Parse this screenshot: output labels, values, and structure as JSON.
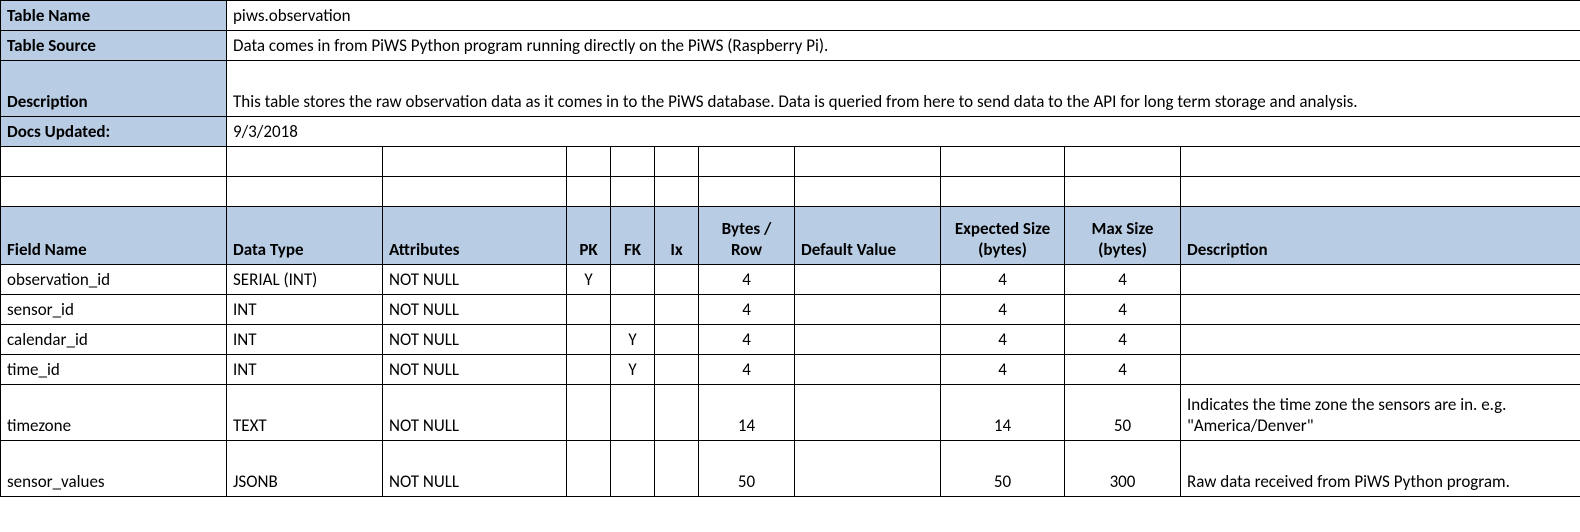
{
  "meta": {
    "label_table_name": "Table Name",
    "table_name": "piws.observation",
    "label_table_source": "Table Source",
    "table_source": "Data comes in from PiWS Python program running directly on the PiWS (Raspberry Pi).",
    "label_description": "Description",
    "description": "This table stores the raw observation data as it comes in to the PiWS database.  Data is queried from here to send data to the API for long term storage and analysis.",
    "label_docs_updated": "Docs Updated:",
    "docs_updated": "9/3/2018"
  },
  "columns": {
    "field_name": "Field Name",
    "data_type": "Data Type",
    "attributes": "Attributes",
    "pk": "PK",
    "fk": "FK",
    "ix": "Ix",
    "bytes_row": "Bytes / Row",
    "default_value": "Default Value",
    "expected_size": "Expected Size (bytes)",
    "max_size": "Max Size (bytes)",
    "description": "Description"
  },
  "rows": [
    {
      "field": "observation_id",
      "type": "SERIAL (INT)",
      "attr": "NOT NULL",
      "pk": "Y",
      "fk": "",
      "ix": "",
      "bytes": "4",
      "def": "",
      "exp": "4",
      "max": "4",
      "desc": ""
    },
    {
      "field": "sensor_id",
      "type": "INT",
      "attr": "NOT NULL",
      "pk": "",
      "fk": "",
      "ix": "",
      "bytes": "4",
      "def": "",
      "exp": "4",
      "max": "4",
      "desc": ""
    },
    {
      "field": "calendar_id",
      "type": "INT",
      "attr": "NOT NULL",
      "pk": "",
      "fk": "Y",
      "ix": "",
      "bytes": "4",
      "def": "",
      "exp": "4",
      "max": "4",
      "desc": ""
    },
    {
      "field": "time_id",
      "type": "INT",
      "attr": "NOT NULL",
      "pk": "",
      "fk": "Y",
      "ix": "",
      "bytes": "4",
      "def": "",
      "exp": "4",
      "max": "4",
      "desc": ""
    },
    {
      "field": "timezone",
      "type": "TEXT",
      "attr": "NOT NULL",
      "pk": "",
      "fk": "",
      "ix": "",
      "bytes": "14",
      "def": "",
      "exp": "14",
      "max": "50",
      "desc": "Indicates the time zone the sensors are in.  e.g. \"America/Denver\""
    },
    {
      "field": "sensor_values",
      "type": "JSONB",
      "attr": "NOT NULL",
      "pk": "",
      "fk": "",
      "ix": "",
      "bytes": "50",
      "def": "",
      "exp": "50",
      "max": "300",
      "desc": "Raw data received from PiWS Python program."
    }
  ]
}
